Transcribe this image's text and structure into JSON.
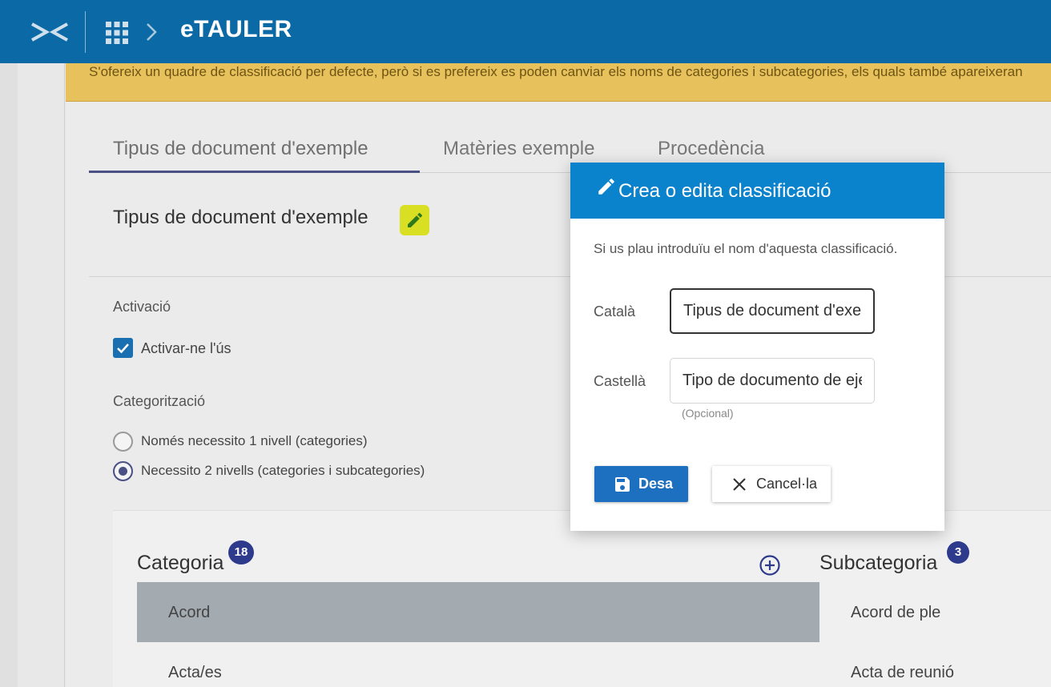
{
  "header": {
    "app_title": "eTAULER",
    "logo_icon": "etauler-logo-icon",
    "apps_icon": "apps-grid-icon",
    "breadcrumb_icon": "chevron-right-icon"
  },
  "notice": {
    "text": "S'ofereix un quadre de classificació per defecte, però si es prefereix es poden canviar els noms de categories i subcategories, els quals també apareixeran"
  },
  "tabs": [
    {
      "label": "Tipus de document d'exemple",
      "active": true
    },
    {
      "label": "Matèries exemple",
      "active": false
    },
    {
      "label": "Procedència",
      "active": false
    }
  ],
  "section": {
    "title": "Tipus de document d'exemple",
    "edit_icon": "pencil-icon"
  },
  "activation": {
    "heading": "Activació",
    "checkbox_label": "Activar-ne l'ús",
    "checked": true
  },
  "categorization": {
    "heading": "Categorització",
    "options": [
      {
        "label": "Només necessito 1 nivell (categories)",
        "selected": false
      },
      {
        "label": "Necessito 2 nivells (categories i subcategories)",
        "selected": true
      }
    ]
  },
  "categories": {
    "title": "Categoria",
    "count": "18",
    "add_icon": "plus-circle-icon",
    "items": [
      "Acord",
      "Acta/es"
    ]
  },
  "subcategories": {
    "title": "Subcategoria",
    "count": "3",
    "items": [
      "Acord de ple",
      "Acta de reunió"
    ]
  },
  "modal": {
    "title": "Crea o edita classificació",
    "title_icon": "pencil-icon",
    "description": "Si us plau introduïu el nom d'aquesta classificació.",
    "fields": [
      {
        "label": "Català",
        "value": "Tipus de document d'exemple"
      },
      {
        "label": "Castellà",
        "value": "Tipo de documento de ejemplo",
        "hint": "(Opcional)"
      }
    ],
    "save_label": "Desa",
    "save_icon": "floppy-disk-icon",
    "cancel_label": "Cancel·la",
    "cancel_icon": "close-icon"
  },
  "colors": {
    "topbar": "#0b6aa6",
    "notice": "#e7c25c",
    "modal_header": "#0b83cc",
    "primary_button": "#1d6fbf",
    "badge": "#2e3a8c",
    "highlight": "#d9e024"
  }
}
